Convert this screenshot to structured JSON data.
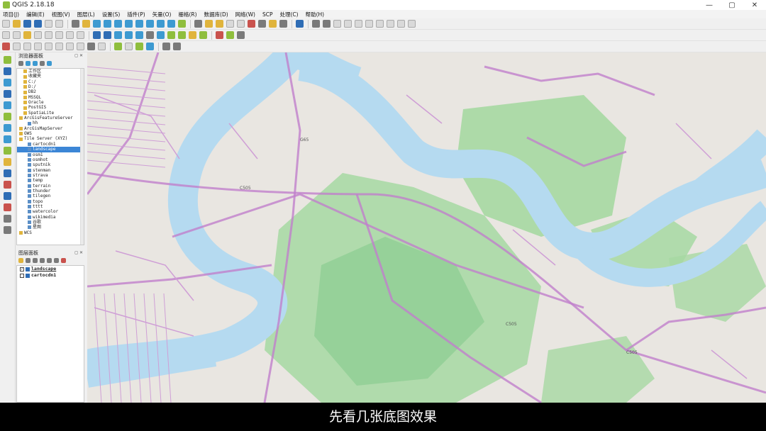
{
  "app": {
    "title": "QGIS 2.18.18"
  },
  "menu": [
    "项目(J)",
    "编辑(E)",
    "视图(V)",
    "图层(L)",
    "设置(S)",
    "插件(P)",
    "矢量(O)",
    "栅格(R)",
    "数据库(D)",
    "网络(W)",
    "SCP",
    "处理(C)",
    "帮助(H)"
  ],
  "browser": {
    "title": "浏览器面板",
    "items": [
      {
        "label": "工作区",
        "indent": 1
      },
      {
        "label": "收藏夹",
        "indent": 1
      },
      {
        "label": "C:/",
        "indent": 1
      },
      {
        "label": "D:/",
        "indent": 1
      },
      {
        "label": "DB2",
        "indent": 1
      },
      {
        "label": "MSSQL",
        "indent": 1
      },
      {
        "label": "Oracle",
        "indent": 1
      },
      {
        "label": "PostGIS",
        "indent": 1
      },
      {
        "label": "SpatiaLite",
        "indent": 1
      },
      {
        "label": "ArcGisFeatureServer",
        "indent": 0
      },
      {
        "label": "hh",
        "indent": 2
      },
      {
        "label": "ArcGisMapServer",
        "indent": 0
      },
      {
        "label": "OWS",
        "indent": 0
      },
      {
        "label": "Tile Server (XYZ)",
        "indent": 0
      },
      {
        "label": "cartocdn1",
        "indent": 2
      },
      {
        "label": "landscape",
        "indent": 2,
        "selected": true
      },
      {
        "label": "osm1",
        "indent": 2
      },
      {
        "label": "osmhot",
        "indent": 2
      },
      {
        "label": "sputnik",
        "indent": 2
      },
      {
        "label": "stenman",
        "indent": 2
      },
      {
        "label": "strava",
        "indent": 2
      },
      {
        "label": "temp",
        "indent": 2
      },
      {
        "label": "terrain",
        "indent": 2
      },
      {
        "label": "thunder",
        "indent": 2
      },
      {
        "label": "tilegen",
        "indent": 2
      },
      {
        "label": "topo",
        "indent": 2
      },
      {
        "label": "tttt",
        "indent": 2
      },
      {
        "label": "watercolor",
        "indent": 2
      },
      {
        "label": "wikimedia",
        "indent": 2
      },
      {
        "label": "谷歌",
        "indent": 2
      },
      {
        "label": "星图",
        "indent": 2
      },
      {
        "label": "WCS",
        "indent": 0
      }
    ]
  },
  "layers": {
    "title": "图层面板",
    "items": [
      {
        "label": "landscape",
        "checked": true
      },
      {
        "label": "cartocdn1",
        "checked": false
      }
    ]
  },
  "map": {
    "colors": {
      "land": "#e9e6e1",
      "water": "#b5daf0",
      "forest": "#a6d8a2",
      "forest_dark": "#86c98c",
      "road": "#cf9fd6",
      "road_major": "#c080cc"
    },
    "road_labels": [
      "G65",
      "C505",
      "C505",
      "C505"
    ]
  },
  "subtitle": "先看几张底图效果"
}
